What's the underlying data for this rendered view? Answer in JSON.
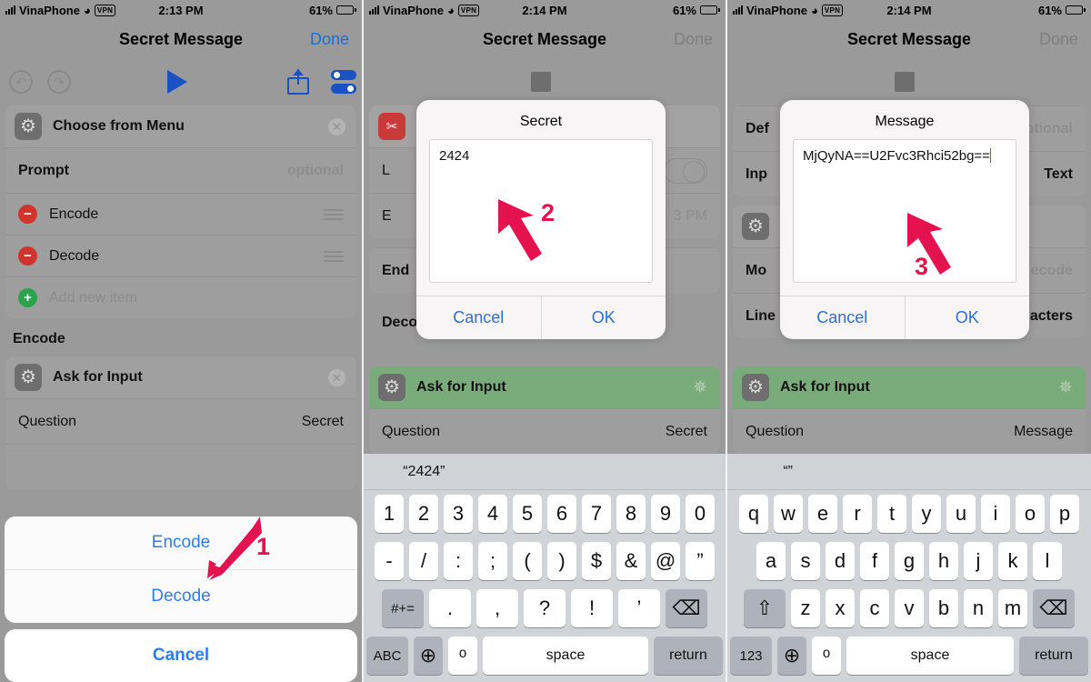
{
  "statusbar": {
    "carrier": "VinaPhone",
    "vpn": "VPN",
    "battery": "61%",
    "time_p1": "2:13 PM",
    "time_p2": "2:14 PM",
    "time_p3": "2:14 PM"
  },
  "nav": {
    "title": "Secret Message",
    "done": "Done"
  },
  "panel1": {
    "menu_card": {
      "title": "Choose from Menu",
      "prompt_label": "Prompt",
      "prompt_value": "optional",
      "items": [
        {
          "label": "Encode",
          "kind": "minus"
        },
        {
          "label": "Decode",
          "kind": "minus"
        },
        {
          "label": "Add new item",
          "kind": "plus"
        }
      ]
    },
    "group_label": "Encode",
    "ask_card": {
      "title": "Ask for Input",
      "question_label": "Question",
      "question_value": "Secret"
    },
    "sheet": {
      "options": [
        "Encode",
        "Decode"
      ],
      "cancel": "Cancel"
    },
    "annotation": "1"
  },
  "panel2": {
    "alert": {
      "title": "Secret",
      "value": "2424",
      "cancel": "Cancel",
      "ok": "OK"
    },
    "background": {
      "rows": [
        "L",
        "E",
        "End",
        "Decod"
      ],
      "time_fragment": "3 PM"
    },
    "ask_card": {
      "title": "Ask for Input",
      "question_label": "Question",
      "question_value": "Secret"
    },
    "annotation": "2",
    "keyboard": {
      "prediction": "“2424”",
      "row1": [
        "1",
        "2",
        "3",
        "4",
        "5",
        "6",
        "7",
        "8",
        "9",
        "0"
      ],
      "row2": [
        "-",
        "/",
        ":",
        ";",
        "(",
        ")",
        "$",
        "&",
        "@",
        "”"
      ],
      "row3_left": "#+=",
      "row3": [
        ".",
        ",",
        "?",
        "!",
        "’"
      ],
      "row3_right": "⌫",
      "row4_left": "ABC",
      "globe": "⊕",
      "mic": "ᵒ",
      "space": "space",
      "return": "return"
    }
  },
  "panel3": {
    "alert": {
      "title": "Message",
      "value": "MjQyNA==U2Fvc3Rhci52bg==",
      "cancel": "Cancel",
      "ok": "OK"
    },
    "background": {
      "default_label": "Def",
      "default_value": "otional",
      "input_label": "Inp",
      "input_value": "Text",
      "mode_label": "Mo",
      "mode_value": "ecode",
      "line_label": "Line",
      "line_value": "acters"
    },
    "ask_card": {
      "title": "Ask for Input",
      "question_label": "Question",
      "question_value": "Message"
    },
    "annotation": "3",
    "keyboard": {
      "prediction": "“”",
      "row1": [
        "q",
        "w",
        "e",
        "r",
        "t",
        "y",
        "u",
        "i",
        "o",
        "p"
      ],
      "row2": [
        "a",
        "s",
        "d",
        "f",
        "g",
        "h",
        "j",
        "k",
        "l"
      ],
      "row3_left": "⇧",
      "row3": [
        "z",
        "x",
        "c",
        "v",
        "b",
        "n",
        "m"
      ],
      "row3_right": "⌫",
      "row4_left": "123",
      "globe": "⊕",
      "mic": "ᵒ",
      "space": "space",
      "return": "return"
    }
  },
  "colors": {
    "dim_background": "#9a9a9a",
    "accent_blue": "#2b7ef0",
    "annotation_red": "#e4134f",
    "running_green": "#7aab7a",
    "remove_red": "#d0342c",
    "add_green": "#2aa34a"
  }
}
